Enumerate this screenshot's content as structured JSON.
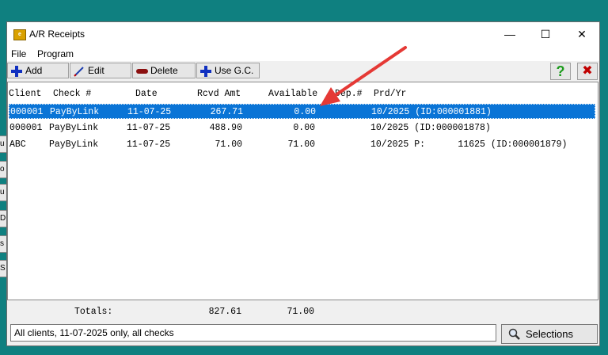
{
  "window": {
    "title": "A/R Receipts",
    "minimize": "—",
    "maximize": "☐",
    "close": "✕"
  },
  "menu": {
    "file": "File",
    "program": "Program"
  },
  "toolbar": {
    "add": "Add",
    "edit": "Edit",
    "delete": "Delete",
    "use_gc": "Use G.C.",
    "help": "?",
    "exit": "✖"
  },
  "columns": {
    "client": "Client",
    "check": "Check #",
    "date": "Date",
    "rcvd": "Rcvd Amt",
    "available": "Available",
    "dep": "Dep.#",
    "prdyr": "Prd/Yr"
  },
  "rows": [
    {
      "client": "000001",
      "check": "PayByLink",
      "date": "11-07-25",
      "rcvd": "267.71",
      "available": "0.00",
      "prdyr": "10/2025 (ID:000001881)"
    },
    {
      "client": "000001",
      "check": "PayByLink",
      "date": "11-07-25",
      "rcvd": "488.90",
      "available": "0.00",
      "prdyr": "10/2025 (ID:000001878)"
    },
    {
      "client": "ABC",
      "check": "PayByLink",
      "date": "11-07-25",
      "rcvd": "71.00",
      "available": "71.00",
      "prdyr": "10/2025 P:      11625 (ID:000001879)"
    }
  ],
  "totals": {
    "label": "Totals:",
    "rcvd": "827.61",
    "available": "71.00"
  },
  "status": {
    "text": "All clients, 11-07-2025 only, all checks"
  },
  "selections": {
    "label": "Selections"
  },
  "background_strips": [
    "u",
    "o",
    "u",
    "D",
    "s",
    "S"
  ],
  "colors": {
    "accent": "#0a74d6",
    "desktop": "#0f8080",
    "arrow": "#e53935"
  }
}
